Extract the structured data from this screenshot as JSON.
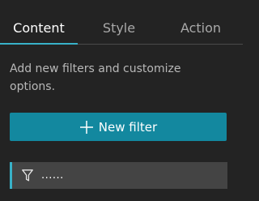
{
  "tabs": [
    {
      "label": "Content",
      "active": true
    },
    {
      "label": "Style",
      "active": false
    },
    {
      "label": "Action",
      "active": false
    }
  ],
  "description": "Add new filters and customize options.",
  "new_filter_button": {
    "label": "New filter",
    "icon": "plus-icon"
  },
  "filters": [
    {
      "label": "......",
      "icon": "funnel-icon"
    }
  ],
  "colors": {
    "accent": "#38b1c8",
    "button": "#13889f",
    "background": "#232323",
    "filter_row": "#444444"
  }
}
